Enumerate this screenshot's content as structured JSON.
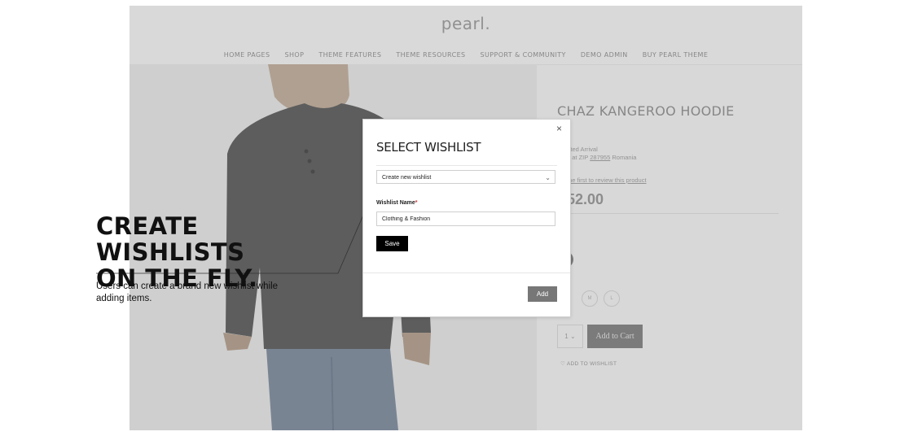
{
  "site": {
    "logo": "pearl.",
    "nav": [
      "HOME PAGES",
      "SHOP",
      "THEME FEATURES",
      "THEME RESOURCES",
      "SUPPORT & COMMUNITY",
      "DEMO ADMIN",
      "BUY PEARL THEME"
    ]
  },
  "product": {
    "title": "CHAZ KANGEROO HOODIE",
    "arrival_label": "mated Arrival",
    "arrival_text_pre": "e at ZIP",
    "arrival_zip": "287955",
    "arrival_country": "Romania",
    "review_link": "the first to review this product",
    "price": "52.00",
    "sizes": [
      "M",
      "L"
    ],
    "qty": "1",
    "add_to_cart": "Add to Cart",
    "add_to_wishlist": "ADD TO WISHLIST"
  },
  "modal": {
    "close_icon": "×",
    "title": "SELECT WISHLIST",
    "select_value": "Create new wishlist",
    "field_label": "Wishlist Name",
    "required_mark": "*",
    "name_value": "Clothing & Fashion",
    "save_label": "Save",
    "add_label": "Add"
  },
  "callout": {
    "heading": "CREATE WISHLISTS\nON THE FLY.",
    "description": "Users can create a brand new wishlist while adding items."
  },
  "icons": {
    "chevron": "chevron-down-icon",
    "heart": "heart-icon",
    "close": "close-icon"
  }
}
